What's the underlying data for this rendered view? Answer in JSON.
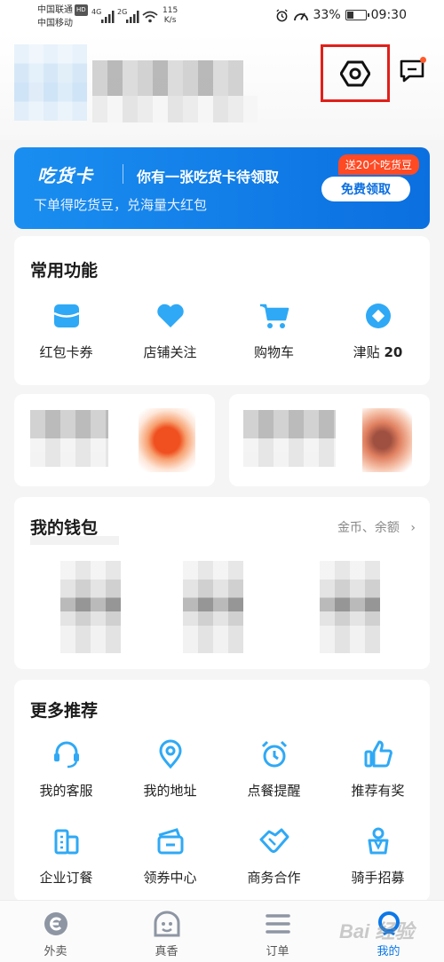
{
  "status_bar": {
    "carrier1": "中国联通",
    "carrier1_badge": "HD",
    "carrier2": "中国移动",
    "net1": "4G",
    "net2": "2G",
    "speed_value": "115",
    "speed_unit": "K/s",
    "battery_text": "33%",
    "battery_level": 0.33,
    "time": "09:30"
  },
  "header": {
    "settings_icon": "settings-hex-icon",
    "message_icon": "message-icon"
  },
  "banner": {
    "brand": "吃货卡",
    "title": "你有一张吃货卡待领取",
    "subtitle": "下单得吃货豆，兑海量大红包",
    "badge": "送20个吃货豆",
    "cta": "免费领取"
  },
  "common": {
    "title": "常用功能",
    "items": [
      {
        "label": "红包卡券",
        "icon": "coupon-icon"
      },
      {
        "label": "店铺关注",
        "icon": "heart-icon"
      },
      {
        "label": "购物车",
        "icon": "cart-icon"
      },
      {
        "label": "津贴",
        "value": "20",
        "icon": "allowance-icon"
      }
    ]
  },
  "wallet": {
    "title": "我的钱包",
    "link": "金币、余额"
  },
  "more": {
    "title": "更多推荐",
    "items": [
      {
        "label": "我的客服",
        "icon": "headset-icon"
      },
      {
        "label": "我的地址",
        "icon": "location-icon"
      },
      {
        "label": "点餐提醒",
        "icon": "alarm-icon"
      },
      {
        "label": "推荐有奖",
        "icon": "thumbs-up-icon"
      },
      {
        "label": "企业订餐",
        "icon": "building-icon"
      },
      {
        "label": "领券中心",
        "icon": "ticket-icon"
      },
      {
        "label": "商务合作",
        "icon": "handshake-icon"
      },
      {
        "label": "骑手招募",
        "icon": "rider-icon"
      }
    ]
  },
  "tabs": [
    {
      "label": "外卖",
      "icon": "eleme-icon",
      "active": false
    },
    {
      "label": "真香",
      "icon": "ghost-icon",
      "active": false
    },
    {
      "label": "订单",
      "icon": "list-icon",
      "active": false
    },
    {
      "label": "我的",
      "icon": "profile-icon",
      "active": true
    }
  ],
  "colors": {
    "accent": "#0b78e8",
    "banner": "#1a8ef0",
    "badge": "#ff4a24",
    "highlight_box": "#e0201a"
  },
  "watermark": "Bai 经验"
}
